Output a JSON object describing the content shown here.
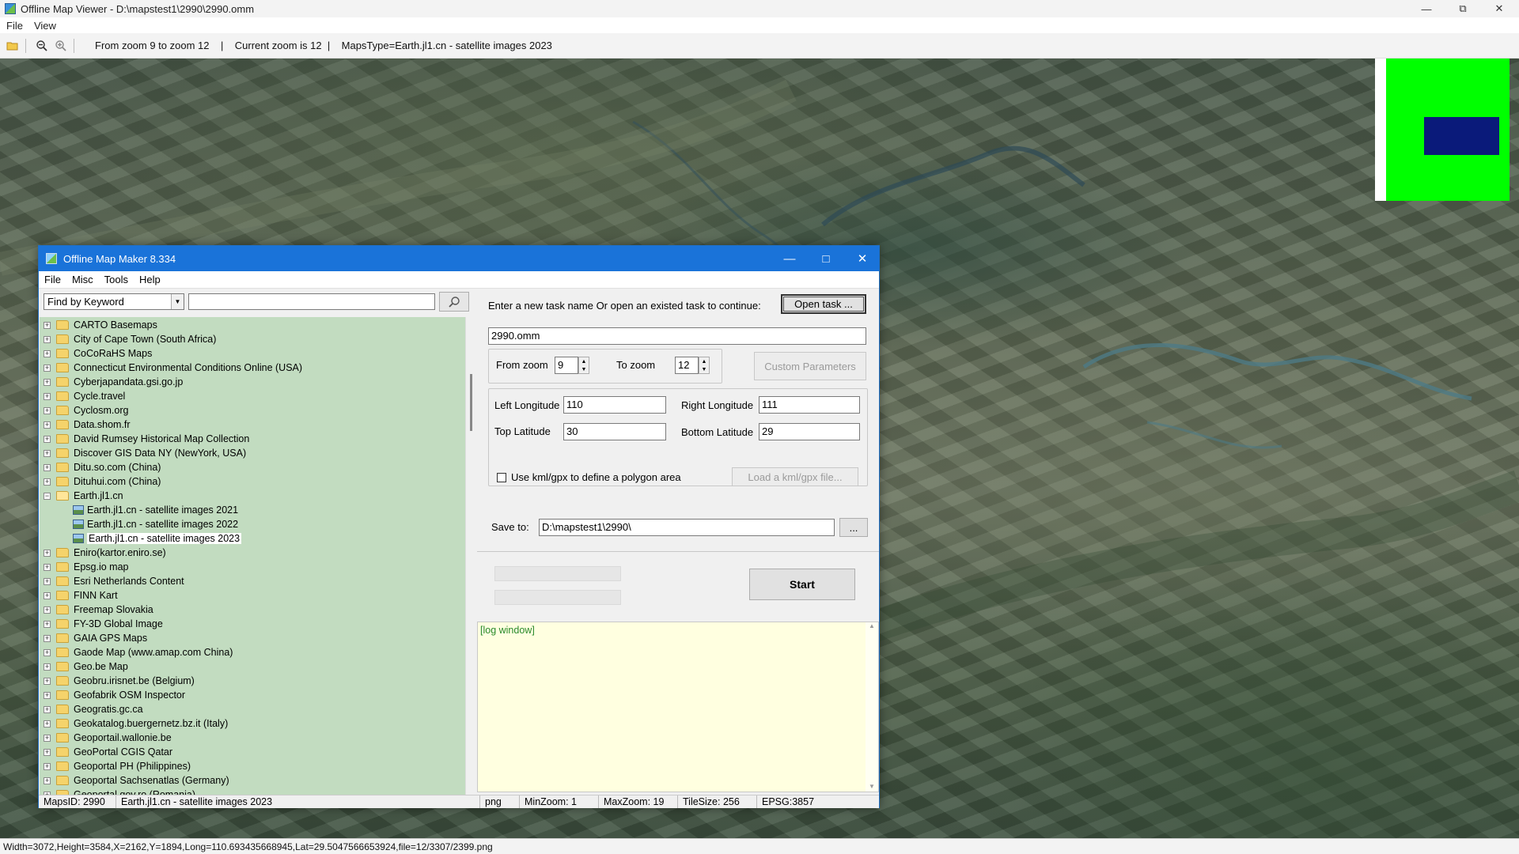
{
  "window": {
    "title": "Offline Map Viewer - D:\\mapstest1\\2990\\2990.omm",
    "menu": [
      "File",
      "View"
    ],
    "toolbar_info": "From zoom 9 to zoom 12    |    Current zoom is 12  |    MapsType=Earth.jl1.cn - satellite images 2023",
    "status": "Width=3072,Height=3584,X=2162,Y=1894,Long=110.693435668945,Lat=29.5047566653924,file=12/3307/2399.png"
  },
  "dialog": {
    "title": "Offline Map Maker 8.334",
    "menu": [
      "File",
      "Misc",
      "Tools",
      "Help"
    ],
    "find_mode": "Find by Keyword",
    "search_value": "",
    "tree": [
      {
        "label": "CARTO Basemaps",
        "kind": "folder"
      },
      {
        "label": "City of Cape Town (South Africa)",
        "kind": "folder"
      },
      {
        "label": "CoCoRaHS Maps",
        "kind": "folder"
      },
      {
        "label": "Connecticut Environmental Conditions Online (USA)",
        "kind": "folder"
      },
      {
        "label": "Cyberjapandata.gsi.go.jp",
        "kind": "folder"
      },
      {
        "label": "Cycle.travel",
        "kind": "folder"
      },
      {
        "label": "Cyclosm.org",
        "kind": "folder"
      },
      {
        "label": "Data.shom.fr",
        "kind": "folder"
      },
      {
        "label": "David Rumsey Historical Map Collection",
        "kind": "folder"
      },
      {
        "label": "Discover GIS Data NY (NewYork, USA)",
        "kind": "folder"
      },
      {
        "label": "Ditu.so.com (China)",
        "kind": "folder"
      },
      {
        "label": "Dituhui.com (China)",
        "kind": "folder"
      },
      {
        "label": "Earth.jl1.cn",
        "kind": "open"
      },
      {
        "label": "Earth.jl1.cn - satellite images 2021",
        "kind": "map"
      },
      {
        "label": "Earth.jl1.cn - satellite images 2022",
        "kind": "map"
      },
      {
        "label": "Earth.jl1.cn - satellite images 2023",
        "kind": "map-selected"
      },
      {
        "label": "Eniro(kartor.eniro.se)",
        "kind": "folder"
      },
      {
        "label": "Epsg.io map",
        "kind": "folder"
      },
      {
        "label": "Esri Netherlands Content",
        "kind": "folder"
      },
      {
        "label": "FINN Kart",
        "kind": "folder"
      },
      {
        "label": "Freemap Slovakia",
        "kind": "folder"
      },
      {
        "label": "FY-3D Global Image",
        "kind": "folder"
      },
      {
        "label": "GAIA GPS Maps",
        "kind": "folder"
      },
      {
        "label": "Gaode Map (www.amap.com China)",
        "kind": "folder"
      },
      {
        "label": "Geo.be Map",
        "kind": "folder"
      },
      {
        "label": "Geobru.irisnet.be (Belgium)",
        "kind": "folder"
      },
      {
        "label": "Geofabrik OSM Inspector",
        "kind": "folder"
      },
      {
        "label": "Geogratis.gc.ca",
        "kind": "folder"
      },
      {
        "label": "Geokatalog.buergernetz.bz.it (Italy)",
        "kind": "folder"
      },
      {
        "label": "Geoportail.wallonie.be",
        "kind": "folder"
      },
      {
        "label": "GeoPortal CGIS Qatar",
        "kind": "folder"
      },
      {
        "label": "Geoportal PH (Philippines)",
        "kind": "folder"
      },
      {
        "label": "Geoportal Sachsenatlas (Germany)",
        "kind": "folder"
      },
      {
        "label": "Geoportal.gov.ro (Romania)",
        "kind": "folder"
      }
    ],
    "task": {
      "prompt": "Enter a new task name Or open an existed task to continue:",
      "open_label": "Open task ...",
      "name": "2990.omm"
    },
    "zoom": {
      "from_label": "From zoom",
      "from_value": "9",
      "to_label": "To zoom",
      "to_value": "12",
      "custom_label": "Custom Parameters"
    },
    "coords": {
      "left_lon_label": "Left Longitude",
      "left_lon": "110",
      "right_lon_label": "Right Longitude",
      "right_lon": "111",
      "top_lat_label": "Top Latitude",
      "top_lat": "30",
      "bottom_lat_label": "Bottom Latitude",
      "bottom_lat": "29",
      "kml_label": "Use kml/gpx to define a polygon area",
      "load_kml_label": "Load a kml/gpx file..."
    },
    "save": {
      "label": "Save to:",
      "path": "D:\\mapstest1\\2990\\",
      "browse": "..."
    },
    "start_label": "Start",
    "log_text": "[log window]",
    "status": {
      "maps_id": "MapsID: 2990",
      "maps_name": "Earth.jl1.cn - satellite images 2023",
      "format": "png",
      "min_zoom": "MinZoom: 1",
      "max_zoom": "MaxZoom: 19",
      "tile_size": "TileSize: 256",
      "epsg": "EPSG:3857"
    }
  }
}
